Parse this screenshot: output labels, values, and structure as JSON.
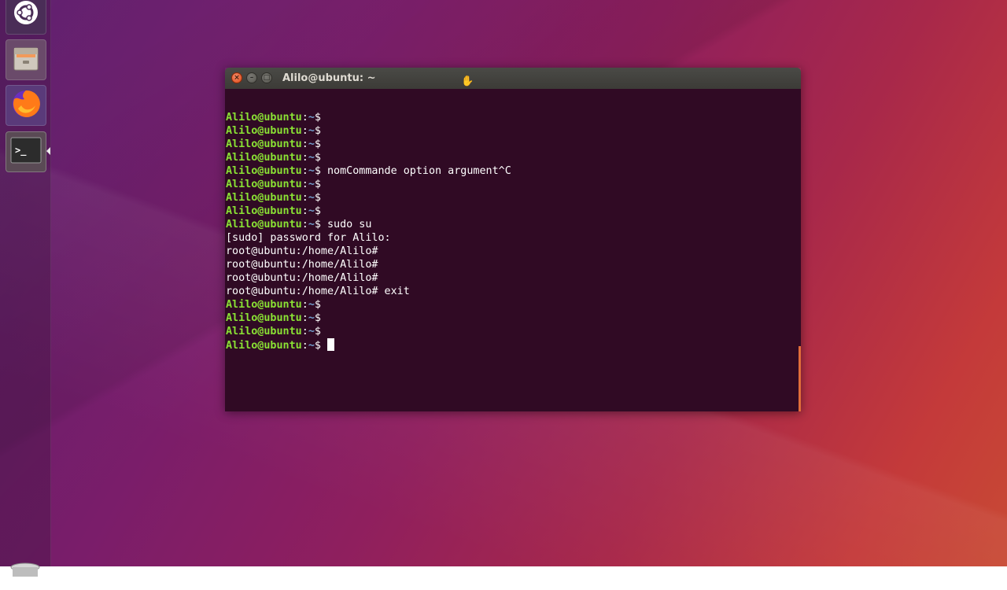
{
  "window": {
    "title": "Alilo@ubuntu: ~",
    "close_glyph": "×",
    "minimize_glyph": "–",
    "maximize_glyph": "□"
  },
  "launcher": {
    "items": [
      {
        "name": "ubuntu-dash-icon"
      },
      {
        "name": "files-icon"
      },
      {
        "name": "firefox-icon"
      },
      {
        "name": "terminal-icon",
        "glyph": ">_"
      },
      {
        "name": "trash-icon"
      }
    ]
  },
  "terminal": {
    "user_prompt": "Alilo@ubuntu",
    "path": "~",
    "root_prompt": "root@ubuntu:/home/Alilo#",
    "lines": [
      {
        "type": "user",
        "cmd": ""
      },
      {
        "type": "user",
        "cmd": ""
      },
      {
        "type": "user",
        "cmd": ""
      },
      {
        "type": "user",
        "cmd": ""
      },
      {
        "type": "user",
        "cmd": " nomCommande option argument^C"
      },
      {
        "type": "user",
        "cmd": ""
      },
      {
        "type": "user",
        "cmd": ""
      },
      {
        "type": "user",
        "cmd": ""
      },
      {
        "type": "user",
        "cmd": " sudo su"
      },
      {
        "type": "text",
        "text": "[sudo] password for Alilo:"
      },
      {
        "type": "root",
        "cmd": ""
      },
      {
        "type": "root",
        "cmd": ""
      },
      {
        "type": "root",
        "cmd": ""
      },
      {
        "type": "root",
        "cmd": " exit"
      },
      {
        "type": "user",
        "cmd": ""
      },
      {
        "type": "user",
        "cmd": ""
      },
      {
        "type": "user",
        "cmd": ""
      },
      {
        "type": "user",
        "cmd": " ",
        "cursor": true
      }
    ]
  },
  "colors": {
    "terminal_bg": "#300a24",
    "prompt_user": "#8ae234",
    "prompt_path": "#729fcf",
    "accent": "#e95420"
  }
}
